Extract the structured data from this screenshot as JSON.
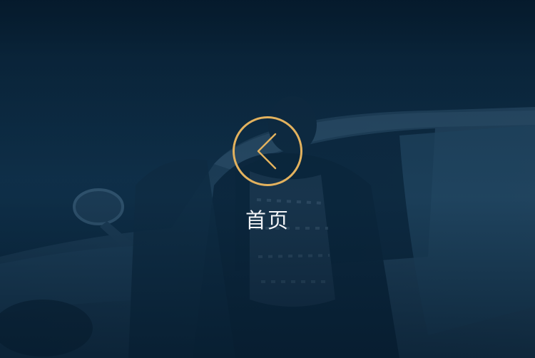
{
  "home": {
    "label": "首页",
    "icon": "chevron-left-icon",
    "accent_color": "#e3b25e"
  },
  "background": {
    "tint_color": "#0e2a42"
  }
}
